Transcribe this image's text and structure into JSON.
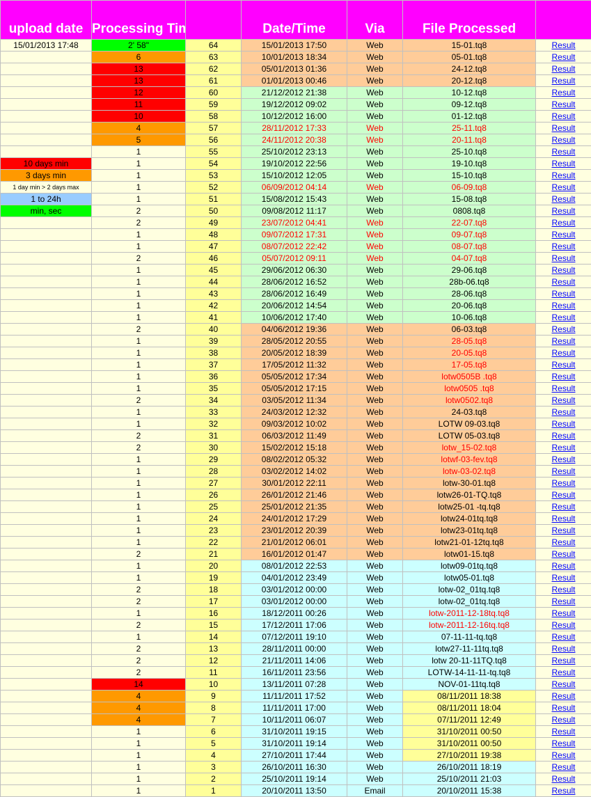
{
  "headers": [
    "upload date",
    "Processing Time",
    "",
    "Date/Time",
    "Via",
    "File Processed",
    ""
  ],
  "legend": {
    "10": "10 days min",
    "11": "3 days min",
    "12": "1 day min > 2 days max",
    "13": "1 to 24h",
    "14": "min, sec"
  },
  "colors": {
    "header": "#ff00ff",
    "light_yellow": "#ffffe0",
    "light_green": "#ccffcc",
    "light_orange": "#ffcc99",
    "light_cyan": "#ccffff",
    "yellow": "#ffff99",
    "red": "#ff0000",
    "orange": "#ff9900",
    "green": "#00ff00",
    "blue": "#99ccff",
    "link": "#0000ff"
  },
  "rows": [
    {
      "upload": "15/01/2013 17:48",
      "pt": "2' 58\"",
      "ptc": "green",
      "num": "64",
      "dt": "15/01/2013 17:50",
      "via": "Web",
      "file": "15-01.tq8",
      "bg": "lo",
      "red": false,
      "fbg": "",
      "result": "Result"
    },
    {
      "upload": "",
      "pt": "6",
      "ptc": "orange",
      "num": "63",
      "dt": "10/01/2013 18:34",
      "via": "Web",
      "file": "05-01.tq8",
      "bg": "lo",
      "red": false,
      "fbg": "",
      "result": "Result"
    },
    {
      "upload": "",
      "pt": "13",
      "ptc": "red",
      "num": "62",
      "dt": "05/01/2013 01:36",
      "via": "Web",
      "file": "24-12.tq8",
      "bg": "lo",
      "red": false,
      "fbg": "",
      "result": "Result"
    },
    {
      "upload": "",
      "pt": "13",
      "ptc": "red",
      "num": "61",
      "dt": "01/01/2013 00:46",
      "via": "Web",
      "file": "20-12.tq8",
      "bg": "lo",
      "red": false,
      "fbg": "",
      "result": "Result"
    },
    {
      "upload": "",
      "pt": "12",
      "ptc": "red",
      "num": "60",
      "dt": "21/12/2012 21:38",
      "via": "Web",
      "file": "10-12.tq8",
      "bg": "lg",
      "red": false,
      "fbg": "",
      "result": "Result"
    },
    {
      "upload": "",
      "pt": "11",
      "ptc": "red",
      "num": "59",
      "dt": "19/12/2012 09:02",
      "via": "Web",
      "file": "09-12.tq8",
      "bg": "lg",
      "red": false,
      "fbg": "",
      "result": "Result"
    },
    {
      "upload": "",
      "pt": "10",
      "ptc": "red",
      "num": "58",
      "dt": "10/12/2012 16:00",
      "via": "Web",
      "file": "01-12.tq8",
      "bg": "lg",
      "red": false,
      "fbg": "",
      "result": "Result"
    },
    {
      "upload": "",
      "pt": "4",
      "ptc": "orange",
      "num": "57",
      "dt": "28/11/2012 17:33",
      "via": "Web",
      "file": "25-11.tq8",
      "bg": "lg",
      "red": true,
      "fbg": "",
      "result": "Result"
    },
    {
      "upload": "",
      "pt": "5",
      "ptc": "orange",
      "num": "56",
      "dt": "24/11/2012 20:38",
      "via": "Web",
      "file": "20-11.tq8",
      "bg": "lg",
      "red": true,
      "fbg": "",
      "result": "Result"
    },
    {
      "upload": "",
      "pt": "1",
      "ptc": "",
      "num": "55",
      "dt": "25/10/2012 23:13",
      "via": "Web",
      "file": "25-10.tq8",
      "bg": "lg",
      "red": false,
      "fbg": "",
      "result": "Result"
    },
    {
      "upload": "",
      "pt": "1",
      "ptc": "",
      "num": "54",
      "dt": "19/10/2012 22:56",
      "via": "Web",
      "file": "19-10.tq8",
      "bg": "lg",
      "red": false,
      "fbg": "",
      "result": "Result"
    },
    {
      "upload": "",
      "pt": "1",
      "ptc": "",
      "num": "53",
      "dt": "15/10/2012 12:05",
      "via": "Web",
      "file": "15-10.tq8",
      "bg": "lg",
      "red": false,
      "fbg": "",
      "result": "Result"
    },
    {
      "upload": "",
      "pt": "1",
      "ptc": "",
      "num": "52",
      "dt": "06/09/2012 04:14",
      "via": "Web",
      "file": "06-09.tq8",
      "bg": "lg",
      "red": true,
      "fbg": "",
      "result": "Result"
    },
    {
      "upload": "",
      "pt": "1",
      "ptc": "",
      "num": "51",
      "dt": "15/08/2012 15:43",
      "via": "Web",
      "file": "15-08.tq8",
      "bg": "lg",
      "red": false,
      "fbg": "",
      "result": "Result"
    },
    {
      "upload": "",
      "pt": "2",
      "ptc": "",
      "num": "50",
      "dt": "09/08/2012 11:17",
      "via": "Web",
      "file": "0808.tq8",
      "bg": "lg",
      "red": false,
      "fbg": "",
      "result": "Result"
    },
    {
      "upload": "",
      "pt": "2",
      "ptc": "",
      "num": "49",
      "dt": "23/07/2012 04:41",
      "via": "Web",
      "file": "22-07.tq8",
      "bg": "lg",
      "red": true,
      "fbg": "",
      "result": "Result"
    },
    {
      "upload": "",
      "pt": "1",
      "ptc": "",
      "num": "48",
      "dt": "09/07/2012 17:31",
      "via": "Web",
      "file": "09-07.tq8",
      "bg": "lg",
      "red": true,
      "fbg": "",
      "result": "Result"
    },
    {
      "upload": "",
      "pt": "1",
      "ptc": "",
      "num": "47",
      "dt": "08/07/2012 22:42",
      "via": "Web",
      "file": "08-07.tq8",
      "bg": "lg",
      "red": true,
      "fbg": "",
      "result": "Result"
    },
    {
      "upload": "",
      "pt": "2",
      "ptc": "",
      "num": "46",
      "dt": "05/07/2012 09:11",
      "via": "Web",
      "file": "04-07.tq8",
      "bg": "lg",
      "red": true,
      "fbg": "",
      "result": "Result"
    },
    {
      "upload": "",
      "pt": "1",
      "ptc": "",
      "num": "45",
      "dt": "29/06/2012 06:30",
      "via": "Web",
      "file": "29-06.tq8",
      "bg": "lg",
      "red": false,
      "fbg": "",
      "result": "Result"
    },
    {
      "upload": "",
      "pt": "1",
      "ptc": "",
      "num": "44",
      "dt": "28/06/2012 16:52",
      "via": "Web",
      "file": "28b-06.tq8",
      "bg": "lg",
      "red": false,
      "fbg": "",
      "result": "Result"
    },
    {
      "upload": "",
      "pt": "1",
      "ptc": "",
      "num": "43",
      "dt": "28/06/2012 16:49",
      "via": "Web",
      "file": "28-06.tq8",
      "bg": "lg",
      "red": false,
      "fbg": "",
      "result": "Result"
    },
    {
      "upload": "",
      "pt": "1",
      "ptc": "",
      "num": "42",
      "dt": "20/06/2012 14:54",
      "via": "Web",
      "file": "20-06.tq8",
      "bg": "lg",
      "red": false,
      "fbg": "",
      "result": "Result"
    },
    {
      "upload": "",
      "pt": "1",
      "ptc": "",
      "num": "41",
      "dt": "10/06/2012 17:40",
      "via": "Web",
      "file": "10-06.tq8",
      "bg": "lg",
      "red": false,
      "fbg": "",
      "result": "Result"
    },
    {
      "upload": "",
      "pt": "2",
      "ptc": "",
      "num": "40",
      "dt": "04/06/2012 19:36",
      "via": "Web",
      "file": "06-03.tq8",
      "bg": "lo",
      "red": false,
      "fbg": "",
      "result": "Result"
    },
    {
      "upload": "",
      "pt": "1",
      "ptc": "",
      "num": "39",
      "dt": "28/05/2012 20:55",
      "via": "Web",
      "file": "28-05.tq8",
      "bg": "lo",
      "red": false,
      "fred": true,
      "fbg": "",
      "result": "Result"
    },
    {
      "upload": "",
      "pt": "1",
      "ptc": "",
      "num": "38",
      "dt": "20/05/2012 18:39",
      "via": "Web",
      "file": "20-05.tq8",
      "bg": "lo",
      "red": false,
      "fred": true,
      "fbg": "",
      "result": "Result"
    },
    {
      "upload": "",
      "pt": "1",
      "ptc": "",
      "num": "37",
      "dt": "17/05/2012 11:32",
      "via": "Web",
      "file": "17-05.tq8",
      "bg": "lo",
      "red": false,
      "fred": true,
      "fbg": "",
      "result": "Result"
    },
    {
      "upload": "",
      "pt": "1",
      "ptc": "",
      "num": "36",
      "dt": "05/05/2012 17:34",
      "via": "Web",
      "file": "lotw0505B .tq8",
      "bg": "lo",
      "red": false,
      "fred": true,
      "fbg": "",
      "result": "Result"
    },
    {
      "upload": "",
      "pt": "1",
      "ptc": "",
      "num": "35",
      "dt": "05/05/2012 17:15",
      "via": "Web",
      "file": "lotw0505 .tq8",
      "bg": "lo",
      "red": false,
      "fred": true,
      "fbg": "",
      "result": "Result"
    },
    {
      "upload": "",
      "pt": "2",
      "ptc": "",
      "num": "34",
      "dt": "03/05/2012 11:34",
      "via": "Web",
      "file": "lotw0502.tq8",
      "bg": "lo",
      "red": false,
      "fred": true,
      "fbg": "",
      "result": "Result"
    },
    {
      "upload": "",
      "pt": "1",
      "ptc": "",
      "num": "33",
      "dt": "24/03/2012 12:32",
      "via": "Web",
      "file": "24-03.tq8",
      "bg": "lo",
      "red": false,
      "fbg": "",
      "result": "Result"
    },
    {
      "upload": "",
      "pt": "1",
      "ptc": "",
      "num": "32",
      "dt": "09/03/2012 10:02",
      "via": "Web",
      "file": "LOTW 09-03.tq8",
      "bg": "lo",
      "red": false,
      "fbg": "",
      "result": "Result"
    },
    {
      "upload": "",
      "pt": "2",
      "ptc": "",
      "num": "31",
      "dt": "06/03/2012 11:49",
      "via": "Web",
      "file": "LOTW 05-03.tq8",
      "bg": "lo",
      "red": false,
      "fbg": "",
      "result": "Result"
    },
    {
      "upload": "",
      "pt": "2",
      "ptc": "",
      "num": "30",
      "dt": "15/02/2012 15:18",
      "via": "Web",
      "file": "lotw_15-02.tq8",
      "bg": "lo",
      "red": false,
      "fred": true,
      "fbg": "",
      "result": "Result"
    },
    {
      "upload": "",
      "pt": "1",
      "ptc": "",
      "num": "29",
      "dt": "08/02/2012 05:32",
      "via": "Web",
      "file": "lotwf-03-fev.tq8",
      "bg": "lo",
      "red": false,
      "fred": true,
      "fbg": "",
      "result": "Result"
    },
    {
      "upload": "",
      "pt": "1",
      "ptc": "",
      "num": "28",
      "dt": "03/02/2012 14:02",
      "via": "Web",
      "file": "lotw-03-02.tq8",
      "bg": "lo",
      "red": false,
      "fred": true,
      "fbg": "",
      "result": "Result"
    },
    {
      "upload": "",
      "pt": "1",
      "ptc": "",
      "num": "27",
      "dt": "30/01/2012 22:11",
      "via": "Web",
      "file": "lotw-30-01.tq8",
      "bg": "lo",
      "red": false,
      "fbg": "",
      "result": "Result"
    },
    {
      "upload": "",
      "pt": "1",
      "ptc": "",
      "num": "26",
      "dt": "26/01/2012 21:46",
      "via": "Web",
      "file": "lotw26-01-TQ.tq8",
      "bg": "lo",
      "red": false,
      "fbg": "",
      "result": "Result"
    },
    {
      "upload": "",
      "pt": "1",
      "ptc": "",
      "num": "25",
      "dt": "25/01/2012 21:35",
      "via": "Web",
      "file": "lotw25-01 -tq.tq8",
      "bg": "lo",
      "red": false,
      "fbg": "",
      "result": "Result"
    },
    {
      "upload": "",
      "pt": "1",
      "ptc": "",
      "num": "24",
      "dt": "24/01/2012 17:29",
      "via": "Web",
      "file": "lotw24-01tq.tq8",
      "bg": "lo",
      "red": false,
      "fbg": "",
      "result": "Result"
    },
    {
      "upload": "",
      "pt": "1",
      "ptc": "",
      "num": "23",
      "dt": "23/01/2012 20:39",
      "via": "Web",
      "file": "lotw23-01tq.tq8",
      "bg": "lo",
      "red": false,
      "fbg": "",
      "result": "Result"
    },
    {
      "upload": "",
      "pt": "1",
      "ptc": "",
      "num": "22",
      "dt": "21/01/2012 06:01",
      "via": "Web",
      "file": "lotw21-01-12tq.tq8",
      "bg": "lo",
      "red": false,
      "fbg": "",
      "result": "Result"
    },
    {
      "upload": "",
      "pt": "2",
      "ptc": "",
      "num": "21",
      "dt": "16/01/2012 01:47",
      "via": "Web",
      "file": "lotw01-15.tq8",
      "bg": "lo",
      "red": false,
      "fbg": "",
      "result": "Result"
    },
    {
      "upload": "",
      "pt": "1",
      "ptc": "",
      "num": "20",
      "dt": "08/01/2012 22:53",
      "via": "Web",
      "file": "lotw09-01tq.tq8",
      "bg": "lc",
      "red": false,
      "fbg": "",
      "result": "Result"
    },
    {
      "upload": "",
      "pt": "1",
      "ptc": "",
      "num": "19",
      "dt": "04/01/2012 23:49",
      "via": "Web",
      "file": "lotw05-01.tq8",
      "bg": "lc",
      "red": false,
      "fbg": "",
      "result": "Result"
    },
    {
      "upload": "",
      "pt": "2",
      "ptc": "",
      "num": "18",
      "dt": "03/01/2012 00:00",
      "via": "Web",
      "file": "lotw-02_01tq.tq8",
      "bg": "lc",
      "red": false,
      "fbg": "",
      "result": "Result"
    },
    {
      "upload": "",
      "pt": "2",
      "ptc": "",
      "num": "17",
      "dt": "03/01/2012 00:00",
      "via": "Web",
      "file": "lotw-02_01tq.tq8",
      "bg": "lc",
      "red": false,
      "fbg": "",
      "result": "Result"
    },
    {
      "upload": "",
      "pt": "1",
      "ptc": "",
      "num": "16",
      "dt": "18/12/2011 00:26",
      "via": "Web",
      "file": "lotw-2011-12-18tq.tq8",
      "bg": "lc",
      "red": false,
      "fred": true,
      "fbg": "",
      "result": "Result"
    },
    {
      "upload": "",
      "pt": "2",
      "ptc": "",
      "num": "15",
      "dt": "17/12/2011 17:06",
      "via": "Web",
      "file": "lotw-2011-12-16tq.tq8",
      "bg": "lc",
      "red": false,
      "fred": true,
      "fbg": "",
      "result": "Result"
    },
    {
      "upload": "",
      "pt": "1",
      "ptc": "",
      "num": "14",
      "dt": "07/12/2011 19:10",
      "via": "Web",
      "file": "07-11-11-tq.tq8",
      "bg": "lc",
      "red": false,
      "fbg": "",
      "result": "Result"
    },
    {
      "upload": "",
      "pt": "2",
      "ptc": "",
      "num": "13",
      "dt": "28/11/2011 00:00",
      "via": "Web",
      "file": "lotw27-11-11tq.tq8",
      "bg": "lc",
      "red": false,
      "fbg": "",
      "result": "Result"
    },
    {
      "upload": "",
      "pt": "2",
      "ptc": "",
      "num": "12",
      "dt": "21/11/2011 14:06",
      "via": "Web",
      "file": "lotw 20-11-11TQ.tq8",
      "bg": "lc",
      "red": false,
      "fbg": "",
      "result": "Result"
    },
    {
      "upload": "",
      "pt": "2",
      "ptc": "",
      "num": "11",
      "dt": "16/11/2011 23:56",
      "via": "Web",
      "file": "LOTW-14-11-11-tq.tq8",
      "bg": "lc",
      "red": false,
      "fbg": "",
      "result": "Result"
    },
    {
      "upload": "",
      "pt": "14",
      "ptc": "red",
      "num": "10",
      "dt": "13/11/2011 07:28",
      "via": "Web",
      "file": "NOV-01-11tq.tq8",
      "bg": "lc",
      "red": false,
      "fbg": "",
      "result": "Result"
    },
    {
      "upload": "",
      "pt": "4",
      "ptc": "orange",
      "num": "9",
      "dt": "11/11/2011 17:52",
      "via": "Web",
      "file": "08/11/2011 18:38",
      "bg": "lc",
      "red": false,
      "fbg": "ly",
      "result": "Result"
    },
    {
      "upload": "",
      "pt": "4",
      "ptc": "orange",
      "num": "8",
      "dt": "11/11/2011 17:00",
      "via": "Web",
      "file": "08/11/2011 18:04",
      "bg": "lc",
      "red": false,
      "fbg": "ly",
      "result": "Result"
    },
    {
      "upload": "",
      "pt": "4",
      "ptc": "orange",
      "num": "7",
      "dt": "10/11/2011 06:07",
      "via": "Web",
      "file": "07/11/2011 12:49",
      "bg": "lc",
      "red": false,
      "fbg": "ly",
      "result": "Result"
    },
    {
      "upload": "",
      "pt": "1",
      "ptc": "",
      "num": "6",
      "dt": "31/10/2011 19:15",
      "via": "Web",
      "file": "31/10/2011 00:50",
      "bg": "lc",
      "red": false,
      "fbg": "ly",
      "result": "Result"
    },
    {
      "upload": "",
      "pt": "1",
      "ptc": "",
      "num": "5",
      "dt": "31/10/2011 19:14",
      "via": "Web",
      "file": "31/10/2011 00:50",
      "bg": "lc",
      "red": false,
      "fbg": "ly",
      "result": "Result"
    },
    {
      "upload": "",
      "pt": "1",
      "ptc": "",
      "num": "4",
      "dt": "27/10/2011 17:44",
      "via": "Web",
      "file": "27/10/2011 19:38",
      "bg": "lc",
      "red": false,
      "fbg": "ly",
      "result": "Result"
    },
    {
      "upload": "",
      "pt": "1",
      "ptc": "",
      "num": "3",
      "dt": "26/10/2011 16:30",
      "via": "Web",
      "file": "26/10/2011 18:19",
      "bg": "lc",
      "red": false,
      "fbg": "",
      "result": "Result"
    },
    {
      "upload": "",
      "pt": "1",
      "ptc": "",
      "num": "2",
      "dt": "25/10/2011 19:14",
      "via": "Web",
      "file": "25/10/2011 21:03",
      "bg": "lc",
      "red": false,
      "fbg": "",
      "result": "Result"
    },
    {
      "upload": "",
      "pt": "1",
      "ptc": "",
      "num": "1",
      "dt": "20/10/2011 13:50",
      "via": "Email",
      "file": "20/10/2011 15:38",
      "bg": "lc",
      "red": false,
      "fbg": "",
      "result": "Result"
    }
  ]
}
